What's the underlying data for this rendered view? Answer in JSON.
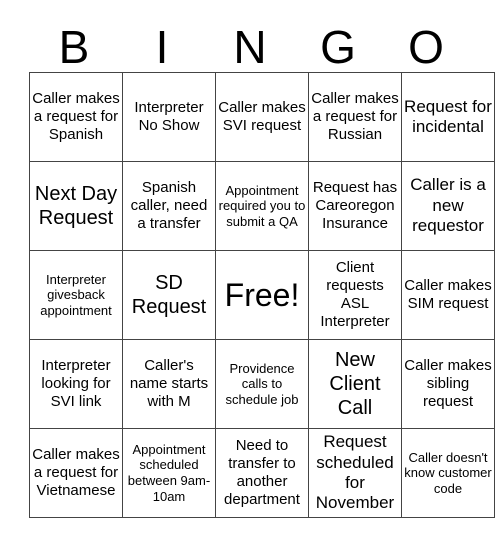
{
  "header": [
    "B",
    "I",
    "N",
    "G",
    "O"
  ],
  "rows": [
    [
      "Caller makes a request for Spanish",
      "Interpreter No Show",
      "Caller makes SVI request",
      "Caller makes a request for Russian",
      "Request for incidental"
    ],
    [
      "Next Day Request",
      "Spanish caller, need a transfer",
      "Appointment required you to submit a QA",
      "Request has Careoregon Insurance",
      "Caller is a new requestor"
    ],
    [
      "Interpreter givesback appointment",
      "SD Request",
      "Free!",
      "Client requests ASL Interpreter",
      "Caller makes SIM request"
    ],
    [
      "Interpreter looking for SVI link",
      "Caller's name starts with M",
      "Providence calls to schedule job",
      "New Client Call",
      "Caller makes sibling request"
    ],
    [
      "Caller makes a request for Vietnamese",
      "Appointment scheduled between 9am-10am",
      "Need to transfer to another department",
      "Request scheduled for November",
      "Caller doesn't know customer code"
    ]
  ]
}
